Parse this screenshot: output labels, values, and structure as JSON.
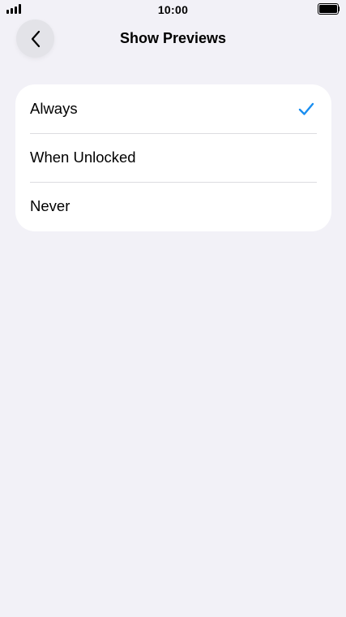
{
  "status_bar": {
    "time": "10:00",
    "signal_icon": "cellular-signal-icon",
    "battery_icon": "battery-full-icon"
  },
  "nav": {
    "title": "Show Previews",
    "back_icon": "chevron-left-icon"
  },
  "options": [
    {
      "label": "Always",
      "selected": true
    },
    {
      "label": "When Unlocked",
      "selected": false
    },
    {
      "label": "Never",
      "selected": false
    }
  ],
  "colors": {
    "accent": "#1a8ef0",
    "background": "#f2f1f7",
    "card": "#ffffff"
  }
}
